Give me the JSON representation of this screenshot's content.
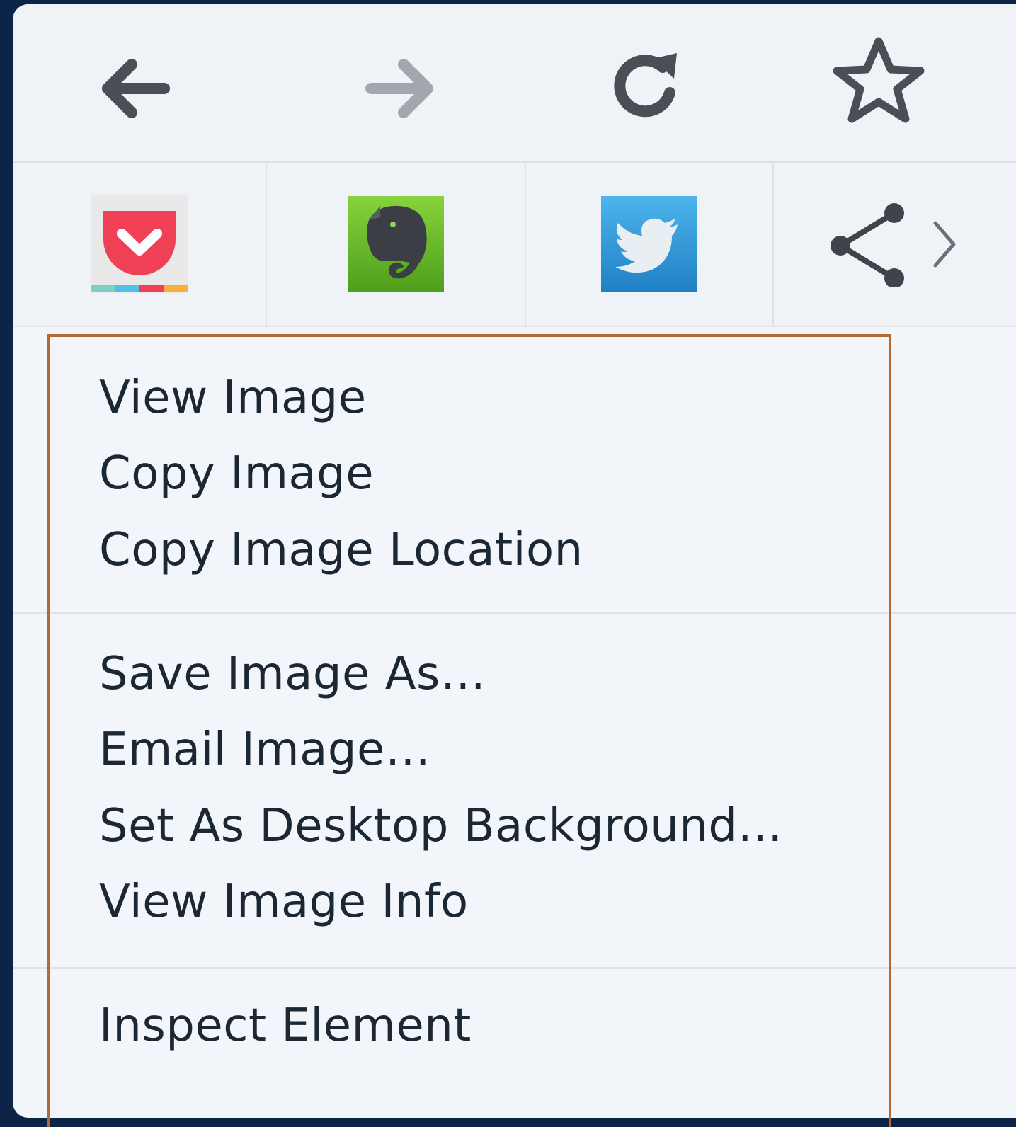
{
  "navigation": {
    "back_icon": "back-arrow-icon",
    "forward_icon": "forward-arrow-icon",
    "reload_icon": "reload-icon",
    "bookmark_icon": "star-icon",
    "forward_disabled": true
  },
  "share": {
    "services": [
      {
        "name": "pocket",
        "icon": "pocket-icon",
        "color": "#ef4056"
      },
      {
        "name": "evernote",
        "icon": "evernote-icon",
        "color": "#6fbf2b"
      },
      {
        "name": "twitter",
        "icon": "twitter-icon",
        "color": "#2f97d8"
      }
    ],
    "more_icon": "share-icon",
    "expand_icon": "chevron-right-icon"
  },
  "menu": {
    "groups": [
      [
        "View Image",
        "Copy Image",
        "Copy Image Location"
      ],
      [
        "Save Image As…",
        "Email Image…",
        "Set As Desktop Background…",
        "View Image Info"
      ],
      [
        "Inspect Element"
      ]
    ]
  },
  "colors": {
    "highlight": "#b5692f",
    "frame": "#0b2447",
    "menu_background": "#f2f5fa",
    "text": "#1b2733"
  }
}
